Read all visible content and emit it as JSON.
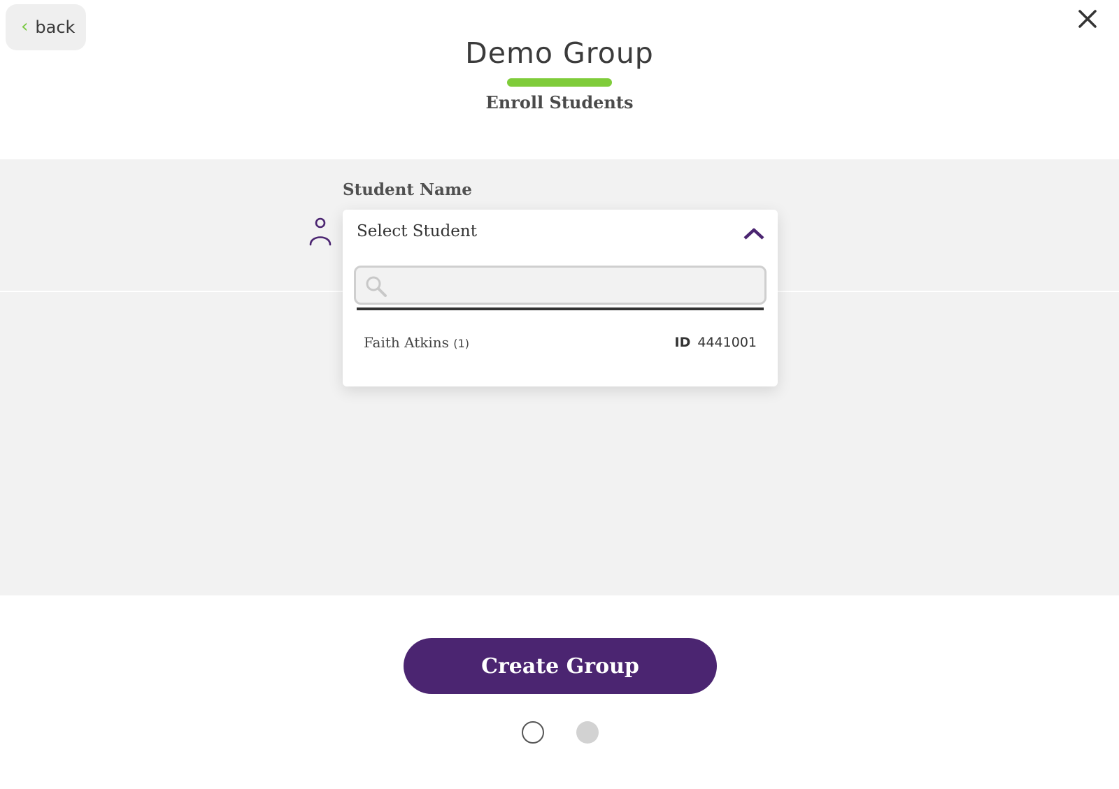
{
  "nav": {
    "back_label": "back",
    "back_icon": "chevron-left-icon",
    "close_icon": "close-icon"
  },
  "header": {
    "title": "Demo Group",
    "subtitle": "Enroll Students"
  },
  "form": {
    "field_label": "Student Name",
    "field_icon": "person-icon",
    "dropdown": {
      "selected_text": "Select Student",
      "expanded": true,
      "search_value": "",
      "options": [
        {
          "name": "Faith Atkins",
          "count": "(1)",
          "id_label": "ID",
          "id": "4441001"
        }
      ]
    }
  },
  "actions": {
    "create_label": "Create Group"
  },
  "pagination": {
    "pages": 2,
    "current": 1
  },
  "colors": {
    "accent_green": "#7fcc3a",
    "brand_purple": "#4b2571",
    "band_gray": "#f2f2f2"
  }
}
